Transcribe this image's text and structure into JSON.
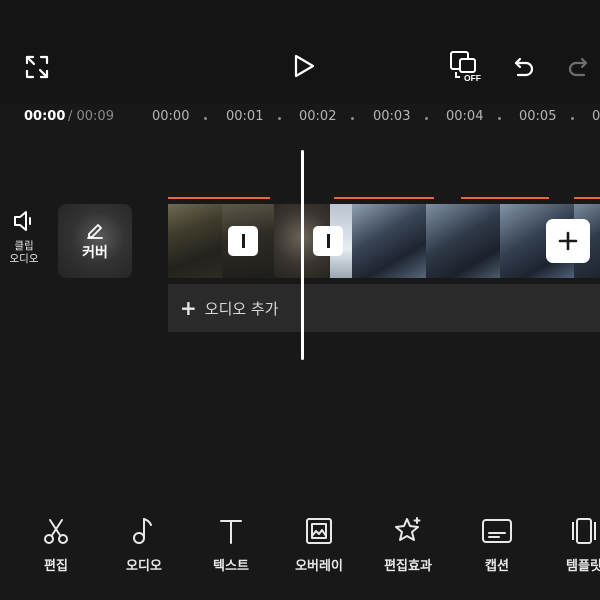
{
  "header": {
    "preview_badge": "OFF"
  },
  "timecode": {
    "current": "00:00",
    "total": "/ 00:09"
  },
  "ruler": [
    "00:00",
    "00:01",
    "00:02",
    "00:03",
    "00:04",
    "00:05",
    "0"
  ],
  "timeline": {
    "clip_audio_label_line1": "클립",
    "clip_audio_label_line2": "오디오",
    "cover_label": "커버",
    "add_audio_plus": "+",
    "add_audio_label": "오디오 추가"
  },
  "colors": {
    "accent_marker": "#e8673a",
    "background": "#181818"
  },
  "icons": {
    "fullscreen": "fullscreen-icon",
    "play": "play-icon",
    "preview": "preview-off-icon",
    "undo": "undo-icon",
    "redo": "redo-icon",
    "speaker": "speaker-icon",
    "pencil": "pencil-icon",
    "add": "plus-icon"
  },
  "toolbar": {
    "edit": "편집",
    "audio": "오디오",
    "text": "텍스트",
    "overlay": "오버레이",
    "effects": "편집효과",
    "captions": "캡션",
    "templates": "템플릿"
  }
}
